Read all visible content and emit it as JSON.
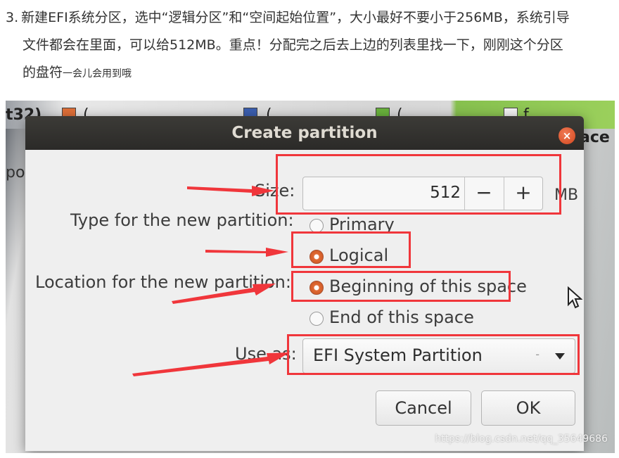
{
  "article": {
    "step_number": "3.",
    "line1": "新建EFI系统分区，选中“逻辑分区”和“空间起始位置”，大小最好不要小于256MB，系统引导",
    "line2": "文件都会在里面，可以给512MB。重点！分配完之后去上边的列表里找一下，刚刚这个分区",
    "line3_main": "的盘符",
    "line3_small": "一会儿会用到哦"
  },
  "background": {
    "frag1": "t32)",
    "frag2": "ace",
    "frag3": "po",
    "partial_labels": [
      "(",
      "(",
      "(",
      "f"
    ],
    "swatch_colors": [
      "#e07038",
      "#3b5fb0",
      "#6ab33d",
      "#f4f4f4"
    ]
  },
  "dialog": {
    "title": "Create partition",
    "close_glyph": "×",
    "size_label": "Size:",
    "size_value": "512",
    "size_unit": "MB",
    "minus": "−",
    "plus": "+",
    "type_label": "Type for the new partition:",
    "type_options": [
      {
        "label": "Primary",
        "selected": false
      },
      {
        "label": "Logical",
        "selected": true
      }
    ],
    "location_label": "Location for the new partition:",
    "location_options": [
      {
        "label": "Beginning of this space",
        "selected": true
      },
      {
        "label": "End of this space",
        "selected": false
      }
    ],
    "use_as_label": "Use as:",
    "use_as_value": "EFI System Partition",
    "use_as_dash": "-",
    "cancel": "Cancel",
    "ok": "OK",
    "accent_color": "#e06a34"
  },
  "annotation_color": "#f0363b",
  "watermark": "https://blog.csdn.net/qq_35649686"
}
